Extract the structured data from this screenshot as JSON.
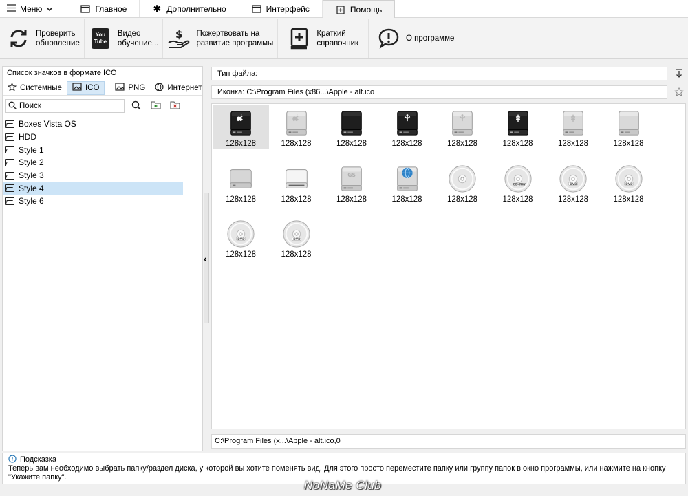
{
  "menu": {
    "label": "Меню"
  },
  "tabs": [
    {
      "label": "Главное"
    },
    {
      "label": "Дополнительно"
    },
    {
      "label": "Интерфейс"
    },
    {
      "label": "Помощь"
    }
  ],
  "ribbon": {
    "check_update": "Проверить\nобновление",
    "video": "Видео\nобучение...",
    "donate": "Пожертвовать на\nразвитие программы",
    "manual": "Краткий\nсправочник",
    "about": "О программе",
    "youtube_icon_text": "You\nTube"
  },
  "left": {
    "title": "Список значков в формате ICO",
    "tabs": [
      "Системные",
      "ICO",
      "PNG",
      "Интернет"
    ],
    "search_placeholder": "Поиск",
    "tree": [
      {
        "label": "Boxes Vista OS"
      },
      {
        "label": "HDD"
      },
      {
        "label": "Style 1"
      },
      {
        "label": "Style 2"
      },
      {
        "label": "Style 3"
      },
      {
        "label": "Style 4"
      },
      {
        "label": "Style 6"
      }
    ]
  },
  "right": {
    "filetype_label": "Тип файла:",
    "icon_path_label": "Иконка:",
    "icon_path_value": "C:\\Program Files (x86...\\Apple - alt.ico",
    "bottom_path": "C:\\Program Files (x...\\Apple - alt.ico,0",
    "icons": [
      {
        "kind": "drive-dark-apple",
        "size": "128x128"
      },
      {
        "kind": "drive-light-apple",
        "size": "128x128"
      },
      {
        "kind": "drive-dark",
        "size": "128x128"
      },
      {
        "kind": "drive-dark-firewire",
        "size": "128x128"
      },
      {
        "kind": "drive-light-firewire",
        "size": "128x128"
      },
      {
        "kind": "drive-dark-usb",
        "size": "128x128"
      },
      {
        "kind": "drive-light-usb",
        "size": "128x128"
      },
      {
        "kind": "drive-light",
        "size": "128x128"
      },
      {
        "kind": "drive-light-flat",
        "size": "128x128"
      },
      {
        "kind": "drive-white-slot",
        "size": "128x128"
      },
      {
        "kind": "drive-light-gs",
        "size": "128x128"
      },
      {
        "kind": "drive-globe",
        "size": "128x128"
      },
      {
        "kind": "disc",
        "size": "128x128"
      },
      {
        "kind": "disc-cdrw",
        "size": "128x128"
      },
      {
        "kind": "disc-dvd",
        "size": "128x128"
      },
      {
        "kind": "disc-dvd",
        "size": "128x128"
      },
      {
        "kind": "disc-dvd",
        "size": "128x128"
      },
      {
        "kind": "disc-dvd",
        "size": "128x128"
      }
    ]
  },
  "hint": {
    "title": "Подсказка",
    "text": "Теперь вам необходимо выбрать папку/раздел диска, у которой вы хотите поменять вид. Для этого просто переместите папку или группу папок в окно программы, или нажмите на кнопку \"Укажите папку\"."
  },
  "watermark": "NoNaMe Club"
}
